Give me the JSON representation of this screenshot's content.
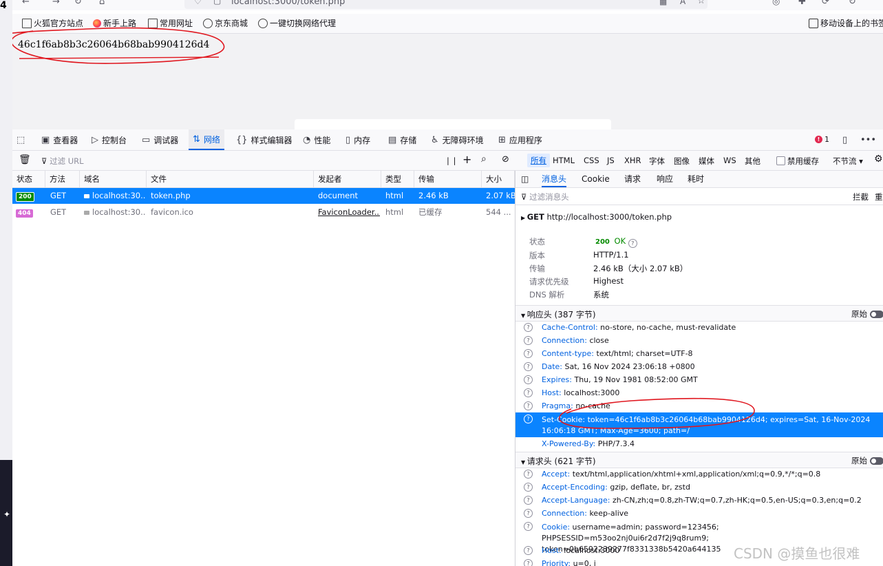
{
  "browser": {
    "url": "localhost:3000/token.php",
    "bookmarks": [
      "火狐官方站点",
      "新手上路",
      "常用网址",
      "京东商城",
      "一键切换网络代理"
    ],
    "mobile_bookmarks": "移动设备上的书签"
  },
  "page": {
    "token_text": "46c1f6ab8b3c26064b68bab9904126d4"
  },
  "devtools": {
    "tabs": [
      "查看器",
      "控制台",
      "调试器",
      "网络",
      "样式编辑器",
      "性能",
      "内存",
      "存储",
      "无障碍环境",
      "应用程序"
    ],
    "active_tab": "网络",
    "error_count": "1",
    "filter_placeholder": "过滤 URL",
    "type_filters": [
      "所有",
      "HTML",
      "CSS",
      "JS",
      "XHR",
      "字体",
      "图像",
      "媒体",
      "WS",
      "其他"
    ],
    "disable_cache": "禁用缓存",
    "throttle": "不节流 ▾"
  },
  "requests": {
    "columns": [
      "状态",
      "方法",
      "域名",
      "文件",
      "发起者",
      "类型",
      "传输",
      "大小"
    ],
    "rows": [
      {
        "status": "200",
        "method": "GET",
        "domain": "localhost:30...",
        "file": "token.php",
        "initiator": "document",
        "type": "html",
        "transferred": "2.46 kB",
        "size": "2.07 kB"
      },
      {
        "status": "404",
        "method": "GET",
        "domain": "localhost:30...",
        "file": "favicon.ico",
        "initiator": "FaviconLoader....",
        "type": "html",
        "transferred": "已缓存",
        "size": "544 ..."
      }
    ]
  },
  "details": {
    "tabs": [
      "消息头",
      "Cookie",
      "请求",
      "响应",
      "耗时"
    ],
    "filter_placeholder": "过滤消息头",
    "block_label": "拦截",
    "resend_label": "重发",
    "request_line": {
      "method": "GET",
      "url": "http://localhost:3000/token.php"
    },
    "meta": [
      {
        "k": "状态",
        "v": "200 OK"
      },
      {
        "k": "版本",
        "v": "HTTP/1.1"
      },
      {
        "k": "传输",
        "v": "2.46 kB（大小 2.07 kB）"
      },
      {
        "k": "请求优先级",
        "v": "Highest"
      },
      {
        "k": "DNS 解析",
        "v": "系统"
      }
    ],
    "status_code": "200",
    "status_text": "OK",
    "response_section": "响应头 (387 字节)",
    "request_section": "请求头 (621 字节)",
    "raw_label": "原始",
    "response_headers": [
      {
        "k": "Cache-Control:",
        "v": "no-store, no-cache, must-revalidate"
      },
      {
        "k": "Connection:",
        "v": "close"
      },
      {
        "k": "Content-type:",
        "v": "text/html; charset=UTF-8"
      },
      {
        "k": "Date:",
        "v": "Sat, 16 Nov 2024 23:06:18 +0800"
      },
      {
        "k": "Expires:",
        "v": "Thu, 19 Nov 1981 08:52:00 GMT"
      },
      {
        "k": "Host:",
        "v": "localhost:3000"
      },
      {
        "k": "Pragma:",
        "v": "no-cache"
      },
      {
        "k": "Set-Cookie:",
        "v": "token=46c1f6ab8b3c26064b68bab9904126d4; expires=Sat, 16-Nov-2024 16:06:18 GMT; Max-Age=3600; path=/"
      },
      {
        "k": "X-Powered-By:",
        "v": "PHP/7.3.4"
      }
    ],
    "request_headers": [
      {
        "k": "Accept:",
        "v": "text/html,application/xhtml+xml,application/xml;q=0.9,*/*;q=0.8"
      },
      {
        "k": "Accept-Encoding:",
        "v": "gzip, deflate, br, zstd"
      },
      {
        "k": "Accept-Language:",
        "v": "zh-CN,zh;q=0.8,zh-TW;q=0.7,zh-HK;q=0.5,en-US;q=0.3,en;q=0.2"
      },
      {
        "k": "Connection:",
        "v": "keep-alive"
      },
      {
        "k": "Cookie:",
        "v": "username=admin; password=123456; PHPSESSID=m53oo2nj0ui6r2d7f2j9q8rum9; token=0b6592239277f8331338b5420a644135"
      },
      {
        "k": "Host:",
        "v": "localhost:3000"
      },
      {
        "k": "Priority:",
        "v": "u=0, i"
      }
    ]
  },
  "watermark": "CSDN @摸鱼也很难",
  "colors": {
    "accent": "#0061e0",
    "selection": "#0a84ff",
    "annotation": "#e0161e"
  }
}
